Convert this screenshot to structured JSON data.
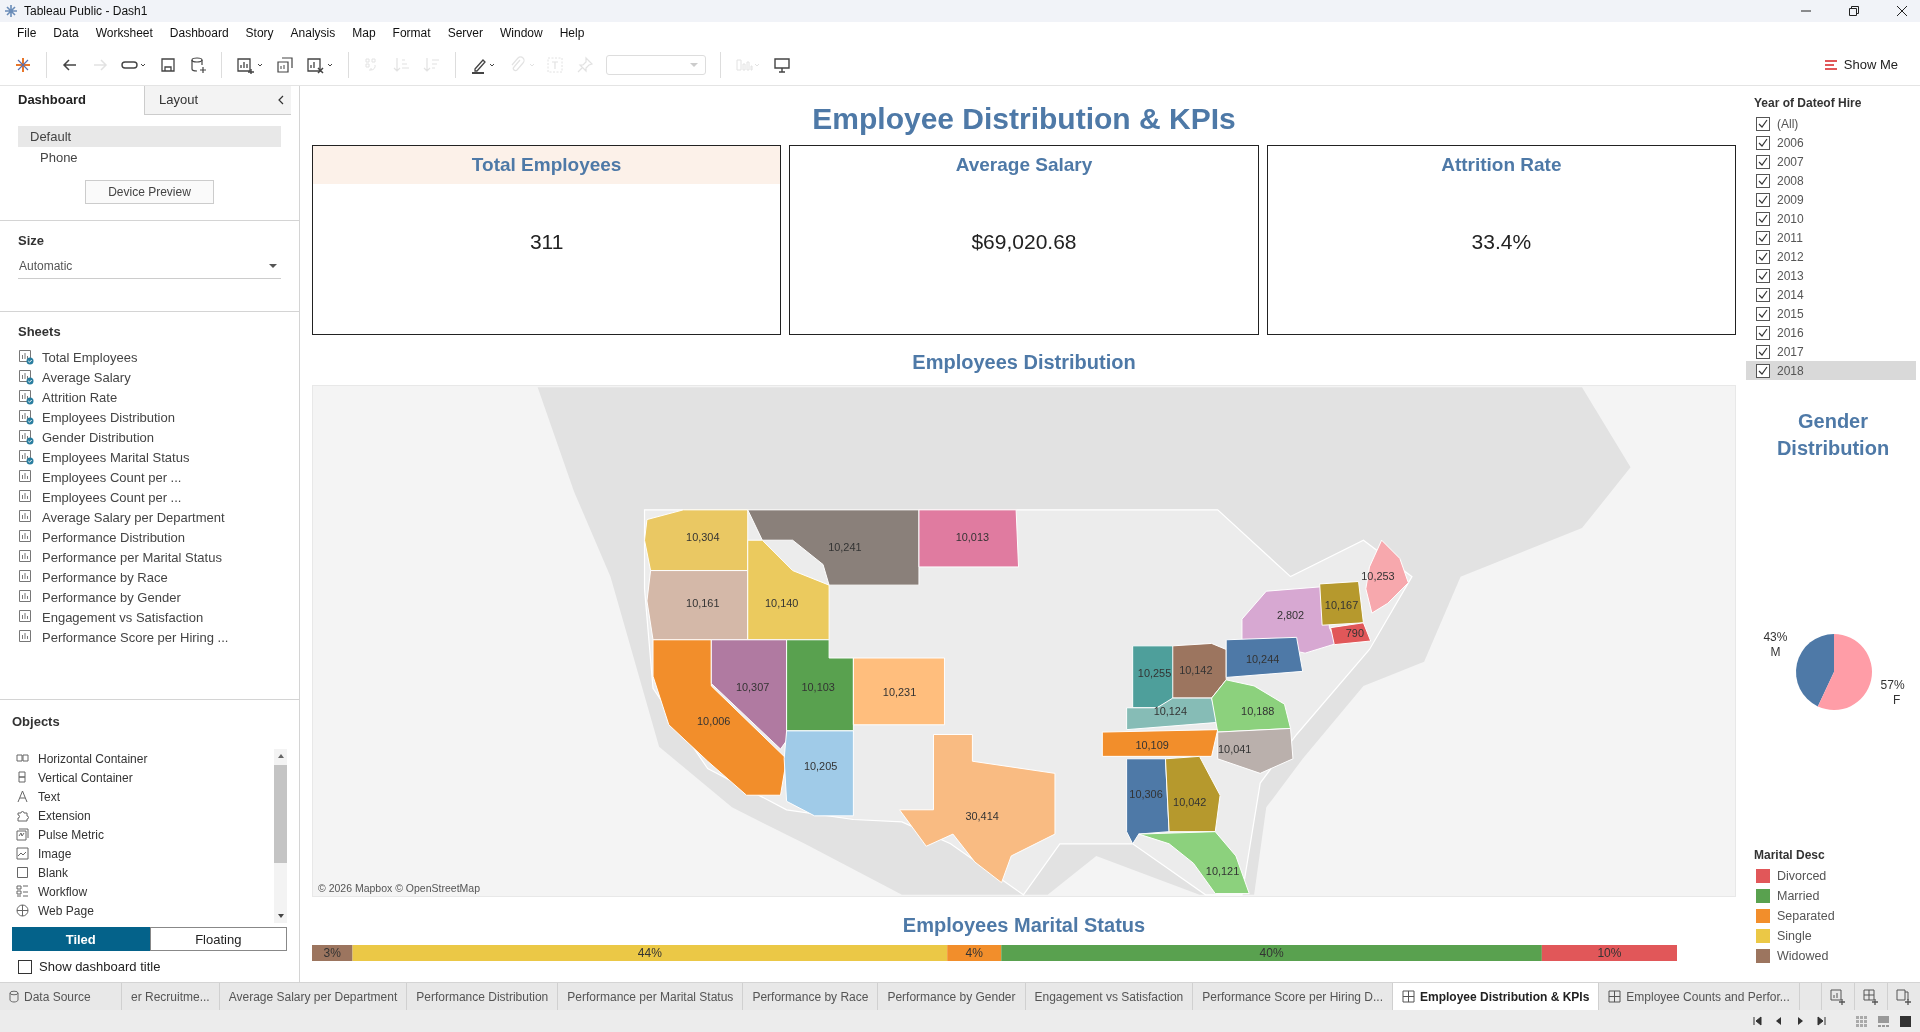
{
  "window": {
    "title": "Tableau Public - Dash1"
  },
  "menu": [
    "File",
    "Data",
    "Worksheet",
    "Dashboard",
    "Story",
    "Analysis",
    "Map",
    "Format",
    "Server",
    "Window",
    "Help"
  ],
  "toolbar": {
    "buttons": [
      {
        "kind": "logo",
        "disabled": false
      },
      {
        "kind": "back",
        "disabled": false
      },
      {
        "kind": "forward",
        "disabled": true
      },
      {
        "kind": "redo",
        "disabled": false
      },
      {
        "kind": "save",
        "disabled": false
      },
      {
        "kind": "datasource",
        "disabled": false
      },
      {
        "kind": "newsheet",
        "disabled": false
      },
      {
        "kind": "duplicate",
        "disabled": false
      },
      {
        "kind": "clear",
        "disabled": false
      },
      {
        "kind": "swap",
        "disabled": true
      },
      {
        "kind": "sortasc",
        "disabled": true
      },
      {
        "kind": "sortdesc",
        "disabled": true
      },
      {
        "kind": "highlight",
        "disabled": false
      },
      {
        "kind": "annotate",
        "disabled": true
      },
      {
        "kind": "label",
        "disabled": true
      },
      {
        "kind": "pin",
        "disabled": true
      },
      {
        "kind": "fit",
        "disabled": true
      },
      {
        "kind": "cards",
        "disabled": true
      },
      {
        "kind": "present",
        "disabled": false
      }
    ],
    "show_me": "Show Me"
  },
  "side_panel": {
    "tabs": [
      {
        "label": "Dashboard",
        "selected": true
      },
      {
        "label": "Layout",
        "selected": false
      }
    ],
    "devices": [
      {
        "label": "Default",
        "selected": true
      },
      {
        "label": "Phone",
        "selected": false
      }
    ],
    "device_preview": "Device Preview",
    "size": {
      "title": "Size",
      "value": "Automatic"
    },
    "sheets": {
      "title": "Sheets",
      "items": [
        {
          "label": "Total Employees",
          "in_use": true
        },
        {
          "label": "Average Salary",
          "in_use": true
        },
        {
          "label": "Attrition Rate",
          "in_use": true
        },
        {
          "label": "Employees Distribution",
          "in_use": true
        },
        {
          "label": "Gender Distribution",
          "in_use": true
        },
        {
          "label": "Employees Marital Status",
          "in_use": true
        },
        {
          "label": "Employees Count per ...",
          "in_use": false
        },
        {
          "label": "Employees Count per ...",
          "in_use": false
        },
        {
          "label": "Average Salary per Department",
          "in_use": false
        },
        {
          "label": "Performance Distribution",
          "in_use": false
        },
        {
          "label": "Performance per Marital Status",
          "in_use": false
        },
        {
          "label": "Performance by Race",
          "in_use": false
        },
        {
          "label": "Performance by Gender",
          "in_use": false
        },
        {
          "label": "Engagement vs Satisfaction",
          "in_use": false
        },
        {
          "label": "Performance Score per Hiring ...",
          "in_use": false
        }
      ]
    },
    "objects": {
      "title": "Objects",
      "items": [
        {
          "label": "Horizontal Container",
          "kind": "hcontainer"
        },
        {
          "label": "Vertical Container",
          "kind": "vcontainer"
        },
        {
          "label": "Text",
          "kind": "text"
        },
        {
          "label": "Extension",
          "kind": "extension"
        },
        {
          "label": "Pulse Metric",
          "kind": "pulse"
        },
        {
          "label": "Image",
          "kind": "image"
        },
        {
          "label": "Blank",
          "kind": "blank"
        },
        {
          "label": "Workflow",
          "kind": "workflow"
        },
        {
          "label": "Web Page",
          "kind": "webpage"
        }
      ]
    },
    "layout_mode": [
      {
        "label": "Tiled",
        "selected": true
      },
      {
        "label": "Floating",
        "selected": false
      }
    ],
    "show_title": {
      "label": "Show dashboard title",
      "checked": false
    }
  },
  "dashboard": {
    "title": "Employee Distribution & KPIs",
    "kpis": [
      {
        "title": "Total Employees",
        "value": "311",
        "selected": true
      },
      {
        "title": "Average Salary",
        "value": "$69,020.68",
        "selected": false
      },
      {
        "title": "Attrition Rate",
        "value": "33.4%",
        "selected": false
      }
    ],
    "map": {
      "title": "Employees Distribution",
      "attribution": "© 2026 Mapbox © OpenStreetMap",
      "regions": [
        {
          "label": "10,304",
          "color": "#eac863"
        },
        {
          "label": "10,241",
          "color": "#8a807a"
        },
        {
          "label": "10,013",
          "color": "#e07ba0"
        },
        {
          "label": "10,253",
          "color": "#f7a8ad"
        },
        {
          "label": "10,161",
          "color": "#d4b8a8"
        },
        {
          "label": "10,140",
          "color": "#ebca5e"
        },
        {
          "label": "2,802",
          "color": "#d7a8d2"
        },
        {
          "label": "10,167",
          "color": "#b6992d"
        },
        {
          "label": "790",
          "color": "#e15759"
        },
        {
          "label": "10,006",
          "color": "#f28e2b"
        },
        {
          "label": "10,307",
          "color": "#b07aa1"
        },
        {
          "label": "10,103",
          "color": "#59a14f"
        },
        {
          "label": "10,231",
          "color": "#ffbe7d"
        },
        {
          "label": "10,205",
          "color": "#a0cbe8"
        },
        {
          "label": "30,414",
          "color": "#f9bb82"
        },
        {
          "label": "10,255",
          "color": "#4e9f9b"
        },
        {
          "label": "10,142",
          "color": "#9c755f"
        },
        {
          "label": "10,244",
          "color": "#4e79a7"
        },
        {
          "label": "10,124",
          "color": "#86bcb6"
        },
        {
          "label": "10,188",
          "color": "#8cd17d"
        },
        {
          "label": "10,109",
          "color": "#f28e2b"
        },
        {
          "label": "10,041",
          "color": "#bab0ac"
        },
        {
          "label": "10,306",
          "color": "#4e79a7"
        },
        {
          "label": "10,042",
          "color": "#b6992d"
        },
        {
          "label": "10,121",
          "color": "#8cd17d"
        }
      ]
    },
    "marital": {
      "title": "Employees Marital Status",
      "chart_data": {
        "type": "bar",
        "orientation": "horizontal",
        "stacked": true,
        "series": [
          {
            "name": "Widowed",
            "color": "#9c755f",
            "values": [
              3
            ],
            "value_labels": [
              "3%"
            ]
          },
          {
            "name": "Single",
            "color": "#ebc846",
            "values": [
              44
            ],
            "value_labels": [
              "44%"
            ]
          },
          {
            "name": "Separated",
            "color": "#f28e2b",
            "values": [
              4
            ],
            "value_labels": [
              "4%"
            ]
          },
          {
            "name": "Married",
            "color": "#59a14f",
            "values": [
              40
            ],
            "value_labels": [
              "40%"
            ]
          },
          {
            "name": "Divorced",
            "color": "#e15759",
            "values": [
              10
            ],
            "value_labels": [
              "10%"
            ]
          }
        ]
      }
    }
  },
  "filter": {
    "title": "Year of Dateof Hire",
    "items": [
      {
        "label": "(All)",
        "checked": true,
        "selected": false
      },
      {
        "label": "2006",
        "checked": true,
        "selected": false
      },
      {
        "label": "2007",
        "checked": true,
        "selected": false
      },
      {
        "label": "2008",
        "checked": true,
        "selected": false
      },
      {
        "label": "2009",
        "checked": true,
        "selected": false
      },
      {
        "label": "2010",
        "checked": true,
        "selected": false
      },
      {
        "label": "2011",
        "checked": true,
        "selected": false
      },
      {
        "label": "2012",
        "checked": true,
        "selected": false
      },
      {
        "label": "2013",
        "checked": true,
        "selected": false
      },
      {
        "label": "2014",
        "checked": true,
        "selected": false
      },
      {
        "label": "2015",
        "checked": true,
        "selected": false
      },
      {
        "label": "2016",
        "checked": true,
        "selected": false
      },
      {
        "label": "2017",
        "checked": true,
        "selected": false
      },
      {
        "label": "2018",
        "checked": true,
        "selected": true
      }
    ]
  },
  "gender": {
    "title": "Gender Distribution",
    "chart_data": {
      "type": "pie",
      "categories": [
        "M",
        "F"
      ],
      "values": [
        43,
        57
      ],
      "colors": [
        "#4e79a7",
        "#ff9da7"
      ],
      "value_labels": [
        "43%",
        "57%"
      ]
    }
  },
  "legend": {
    "title": "Marital Desc"
  },
  "sheet_tabs": [
    {
      "label": "Data Source",
      "kind": "datasource",
      "selected": false
    },
    {
      "label": "er Recruitme...",
      "kind": "sheet",
      "selected": false
    },
    {
      "label": "Average Salary per Department",
      "kind": "sheet",
      "selected": false
    },
    {
      "label": "Performance Distribution",
      "kind": "sheet",
      "selected": false
    },
    {
      "label": "Performance per Marital Status",
      "kind": "sheet",
      "selected": false
    },
    {
      "label": "Performance by Race",
      "kind": "sheet",
      "selected": false
    },
    {
      "label": "Performance by Gender",
      "kind": "sheet",
      "selected": false
    },
    {
      "label": "Engagement vs Satisfaction",
      "kind": "sheet",
      "selected": false
    },
    {
      "label": "Performance Score per Hiring D...",
      "kind": "sheet",
      "selected": false
    },
    {
      "label": "Employee Distribution & KPIs",
      "kind": "dashboard",
      "selected": true
    },
    {
      "label": "Employee Counts and Perfor...",
      "kind": "dashboard",
      "selected": false
    }
  ]
}
